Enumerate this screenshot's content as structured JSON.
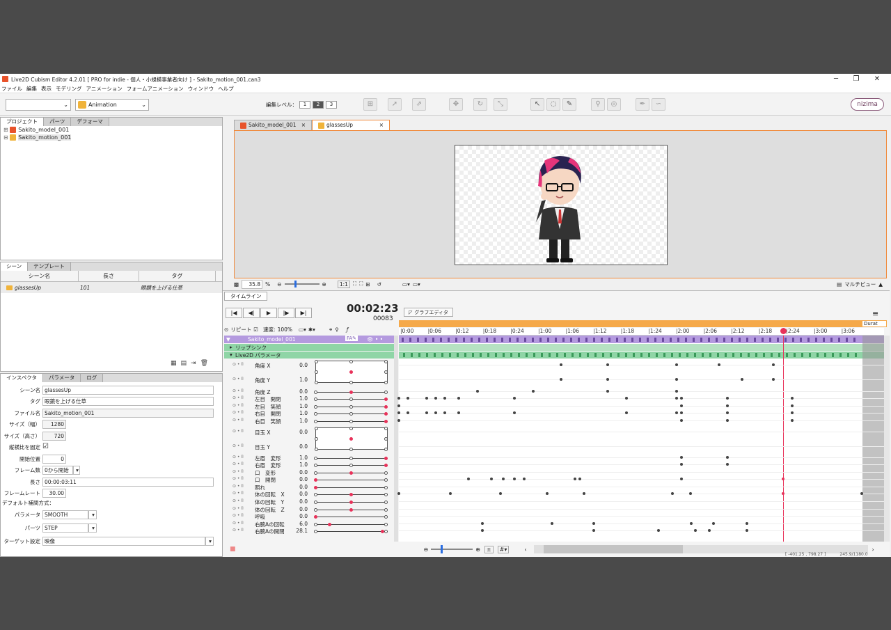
{
  "window": {
    "title": "Live2D Cubism Editor 4.2.01  [ PRO for indie - 個人・小規模事業者向け ] - Sakito_motion_001.can3",
    "minimize": "─",
    "maximize": "❐",
    "close": "✕"
  },
  "menu": [
    "ファイル",
    "編集",
    "表示",
    "モデリング",
    "アニメーション",
    "フォームアニメーション",
    "ウィンドウ",
    "ヘルプ"
  ],
  "toolbar": {
    "mode": "Animation",
    "edit_level_label": "編集レベル：",
    "edit_levels": [
      "1",
      "2",
      "3"
    ],
    "brand": "nizima"
  },
  "project_panel": {
    "tabs": [
      "プロジェクト",
      "パーツ",
      "デフォーマ"
    ],
    "items": [
      "Sakito_model_001",
      "Sakito_motion_001"
    ]
  },
  "scene_panel": {
    "tabs": [
      "シーン",
      "テンプレート"
    ],
    "headers": [
      "シーン名",
      "長さ",
      "タグ"
    ],
    "rows": [
      {
        "name": "glassesUp",
        "length": "101",
        "tag": "眼鏡を上げる仕草"
      }
    ]
  },
  "inspector": {
    "tabs": [
      "インスペクタ",
      "パラメータ",
      "ログ"
    ],
    "fields": [
      {
        "label": "シーン名",
        "value": "glassesUp"
      },
      {
        "label": "タグ",
        "value": "眼鏡を上げる仕草"
      },
      {
        "label": "ファイル名",
        "value": "Sakito_motion_001"
      },
      {
        "label": "サイズ（幅）",
        "value": "1280"
      },
      {
        "label": "サイズ（高さ）",
        "value": "720"
      },
      {
        "label": "縦横比を固定",
        "value": "☑"
      },
      {
        "label": "開始位置",
        "value": "0"
      },
      {
        "label": "フレーム数",
        "value": "0から開始"
      },
      {
        "label": "長さ",
        "value": "00:00:03:11"
      },
      {
        "label": "フレームレート",
        "value": "30.00"
      }
    ],
    "interp_title": "デフォルト補間方式：",
    "interp": [
      {
        "label": "パラメータ",
        "value": "SMOOTH"
      },
      {
        "label": "パーツ",
        "value": "STEP"
      }
    ],
    "target_label": "ターゲット設定",
    "target_value": "映像"
  },
  "viewer": {
    "tabs": [
      "Sakito_model_001",
      "glassesUp"
    ],
    "zoom": "35.8",
    "zoom_unit": "%",
    "fit": "1:1",
    "multiview": "マルチビュー"
  },
  "timeline": {
    "tab": "タイムライン",
    "time": "00:02:23",
    "frame": "00083",
    "graph_editor": "グラフエディタ",
    "repeat_label": "リピート",
    "speed_label": "速度:",
    "speed_value": "100%",
    "fx": "ƒ",
    "model_track": "Sakito_model_001",
    "lipsync": "リップシンク",
    "params_group": "Live2D パラメータ",
    "duration_label": "Durat",
    "ticks": [
      "0:00",
      "0:06",
      "0:12",
      "0:18",
      "0:24",
      "1:00",
      "1:06",
      "1:12",
      "1:18",
      "1:24",
      "2:00",
      "2:06",
      "2:12",
      "2:18",
      "2:24",
      "3:00",
      "3:06"
    ],
    "params": [
      {
        "name": "角度 X",
        "value": "0.0"
      },
      {
        "name": "角度 Y",
        "value": "1.0"
      },
      {
        "name": "角度 Z",
        "value": "0.0"
      },
      {
        "name": "左目　開閉",
        "value": "1.0"
      },
      {
        "name": "左目　笑顔",
        "value": "1.0"
      },
      {
        "name": "右目　開閉",
        "value": "1.0"
      },
      {
        "name": "右目　笑顔",
        "value": "1.0"
      },
      {
        "name": "目玉 X",
        "value": "0.0"
      },
      {
        "name": "目玉 Y",
        "value": "0.0"
      },
      {
        "name": "左眉　変形",
        "value": "1.0"
      },
      {
        "name": "右眉　変形",
        "value": "1.0"
      },
      {
        "name": "口　変形",
        "value": "0.0"
      },
      {
        "name": "口　開閉",
        "value": "0.0"
      },
      {
        "name": "照れ",
        "value": "0.0"
      },
      {
        "name": "体の回転　X",
        "value": "0.0"
      },
      {
        "name": "体の回転　Y",
        "value": "0.0"
      },
      {
        "name": "体の回転　Z",
        "value": "0.0"
      },
      {
        "name": "呼吸",
        "value": "0.0"
      },
      {
        "name": "右腕Aの回転",
        "value": "6.0"
      },
      {
        "name": "右腕Aの開閉",
        "value": "28.1"
      }
    ]
  },
  "status": {
    "coords": "[ -401.25 ,  798.27 ]",
    "info": "245.9/1180.0"
  },
  "colors": {
    "accent": "#f08a3c",
    "purple": "#b49adf",
    "green": "#8fd5a6",
    "playhead": "#e8325a",
    "duration": "#f5a94a"
  }
}
